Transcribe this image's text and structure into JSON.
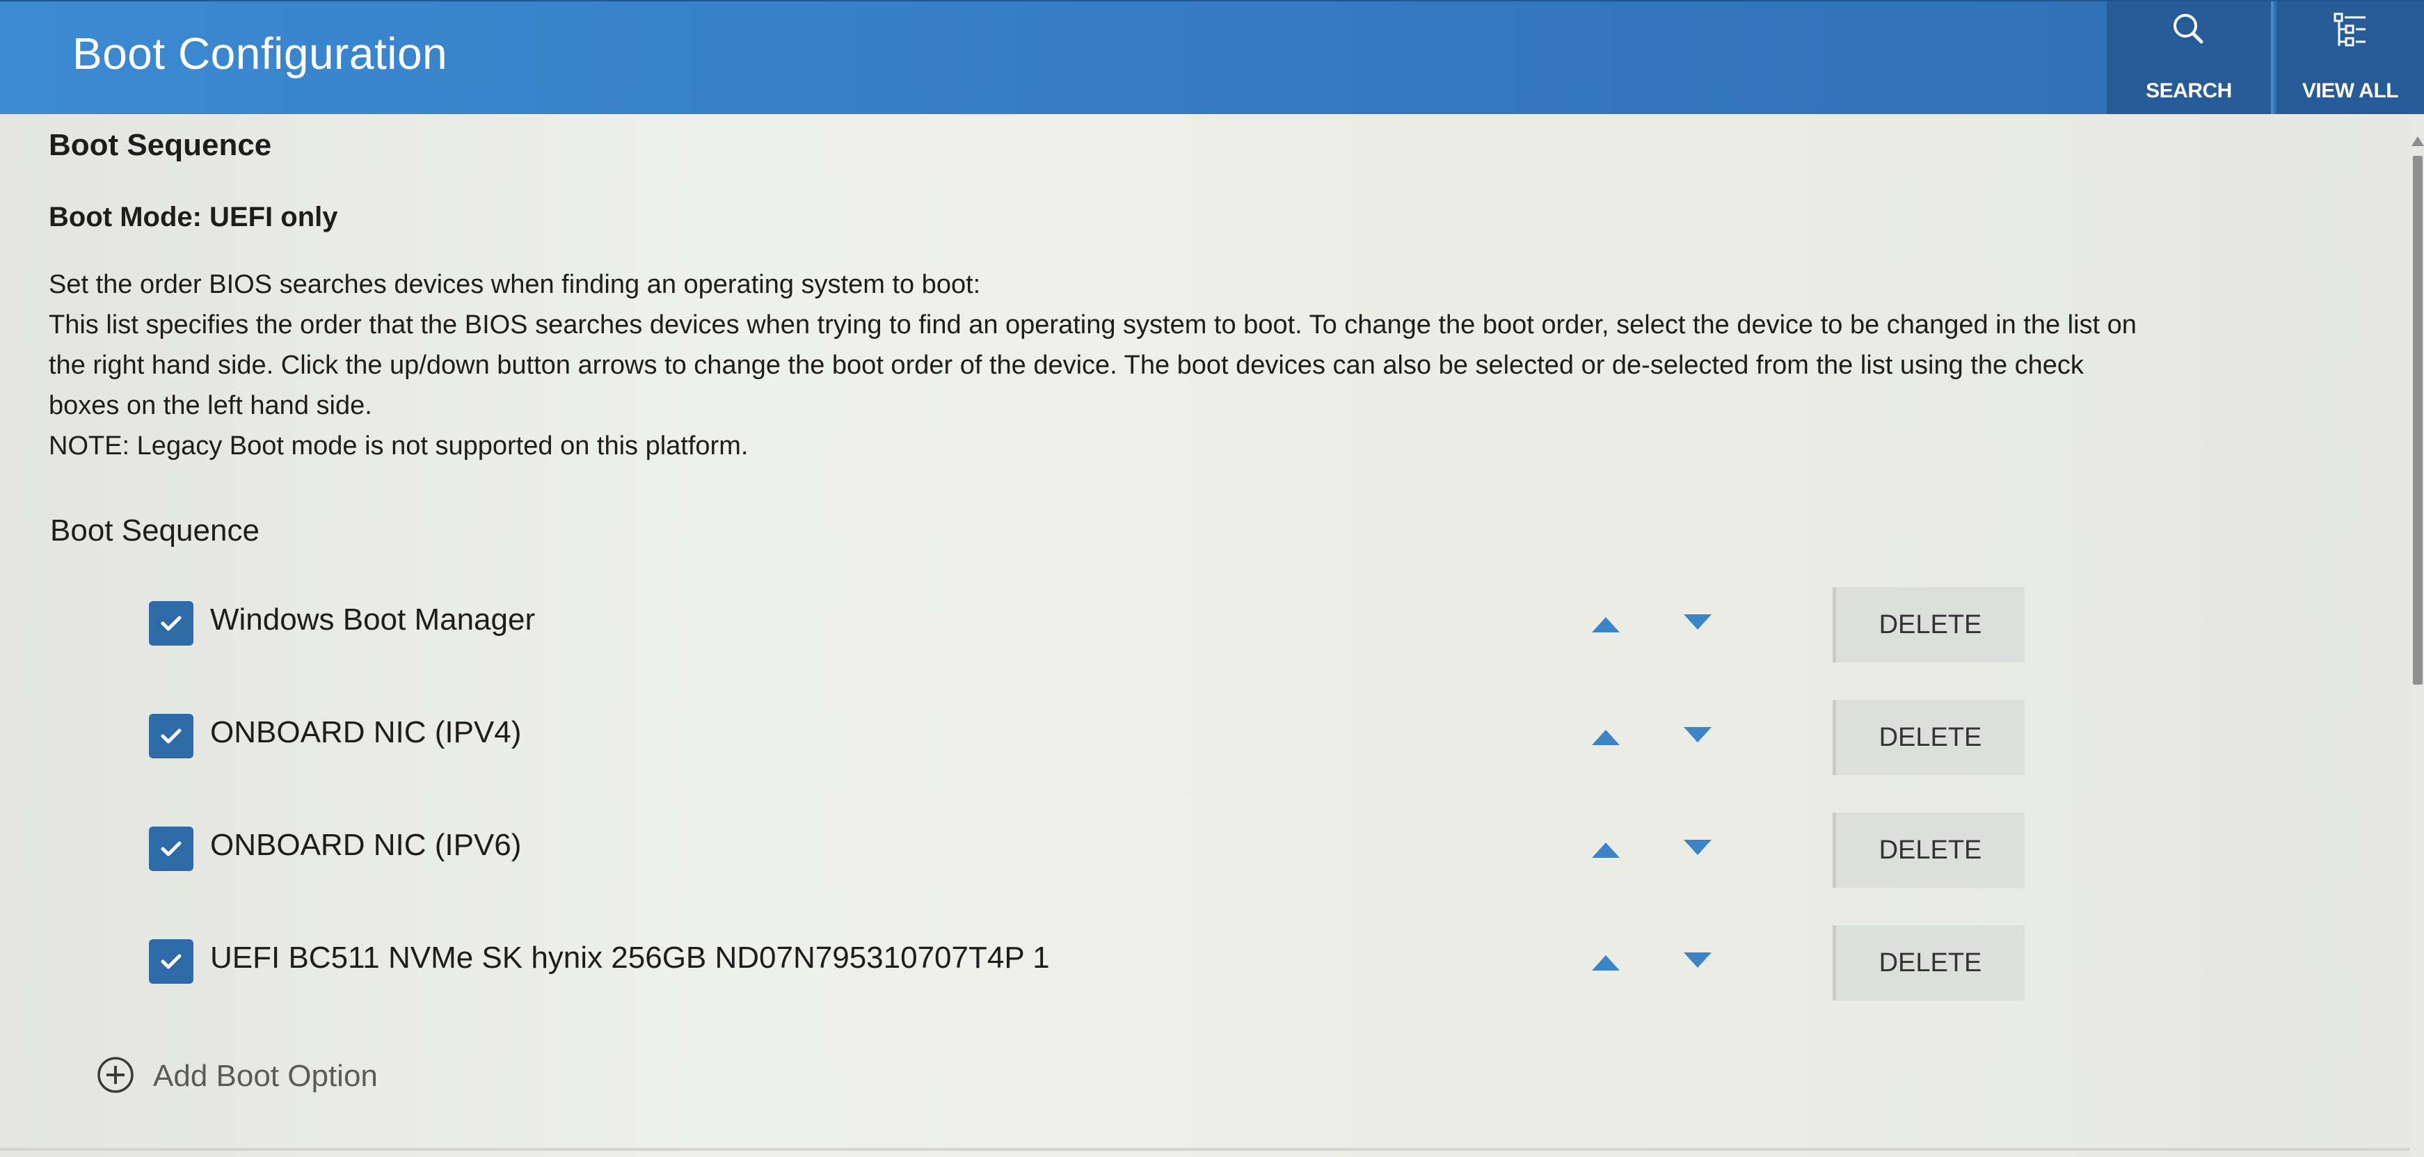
{
  "header": {
    "title": "Boot Configuration",
    "search_label": "SEARCH",
    "view_all_label": "VIEW ALL"
  },
  "section": {
    "heading": "Boot Sequence",
    "boot_mode": "Boot Mode: UEFI only",
    "description_lines": [
      "Set the order BIOS searches devices when finding an operating system to boot:",
      "This list specifies the order that the BIOS searches devices when trying to find an operating system to boot.  To change the boot order, select the device to be changed in the list on",
      "the right hand side.  Click the up/down button arrows to change the boot order of the device.  The boot devices can also be selected or de-selected from the list using the check",
      "boxes on the left hand side.",
      "NOTE: Legacy Boot mode is not supported on this platform."
    ],
    "list_label": "Boot Sequence"
  },
  "boot_devices": [
    {
      "name": "Windows Boot Manager",
      "checked": true,
      "delete_label": "DELETE"
    },
    {
      "name": "ONBOARD NIC (IPV4)",
      "checked": true,
      "delete_label": "DELETE"
    },
    {
      "name": "ONBOARD NIC (IPV6)",
      "checked": true,
      "delete_label": "DELETE"
    },
    {
      "name": "UEFI BC511 NVMe SK hynix 256GB ND07N795310707T4P 1",
      "checked": true,
      "delete_label": "DELETE"
    }
  ],
  "add_boot_option": {
    "label": "Add Boot Option"
  },
  "icons": {
    "search": "search-icon",
    "view_all": "filter-list-icon",
    "checkbox": "checkmark-icon",
    "move_up": "arrow-up-icon",
    "move_down": "arrow-down-icon",
    "add": "plus-circle-icon"
  },
  "colors": {
    "header_bg": "#3478c0",
    "header_button_bg": "#275b95",
    "accent": "#2f6aa8",
    "arrow": "#3c84c6"
  }
}
